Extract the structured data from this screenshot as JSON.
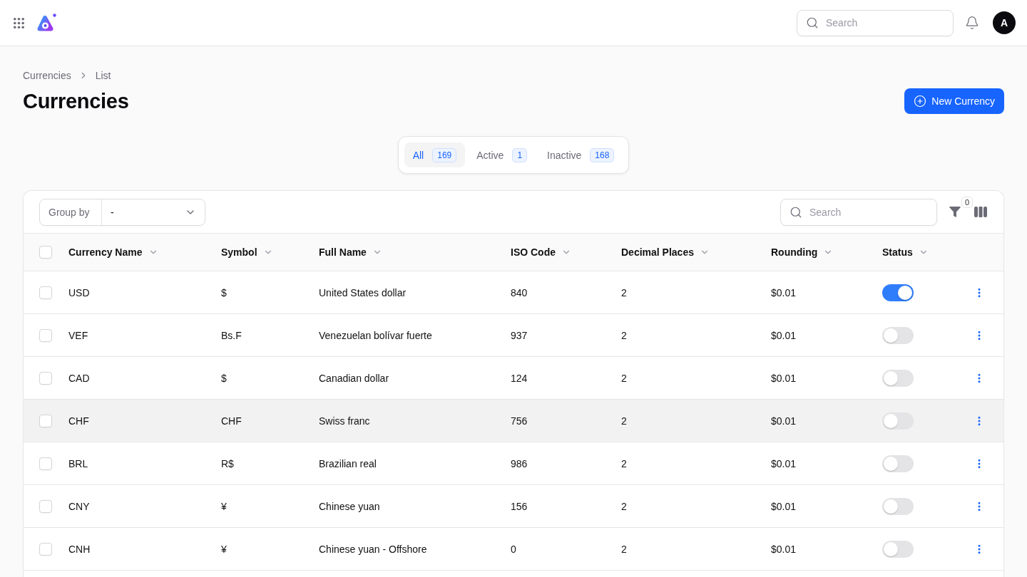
{
  "topbar": {
    "search": {
      "placeholder": "Search"
    },
    "avatar": "A"
  },
  "breadcrumb": [
    "Currencies",
    "List"
  ],
  "title": "Currencies",
  "new_button": "New Currency",
  "tabs": [
    {
      "label": "All",
      "count": "169",
      "selected": true
    },
    {
      "label": "Active",
      "count": "1",
      "selected": false
    },
    {
      "label": "Inactive",
      "count": "168",
      "selected": false
    }
  ],
  "toolbar": {
    "group_by": {
      "label": "Group by",
      "value": "-"
    },
    "search": {
      "placeholder": "Search"
    },
    "filter_count": "0"
  },
  "table": {
    "select_all": {
      "checked": false
    },
    "columns": [
      "Currency Name",
      "Symbol",
      "Full Name",
      "ISO Code",
      "Decimal Places",
      "Rounding",
      "Status"
    ],
    "rows": [
      {
        "checked": false,
        "hovered": false,
        "cells": [
          "USD",
          "$",
          "United States dollar",
          "840",
          "2",
          "$0.01"
        ],
        "on": true
      },
      {
        "checked": false,
        "hovered": false,
        "cells": [
          "VEF",
          "Bs.F",
          "Venezuelan bolívar fuerte",
          "937",
          "2",
          "$0.01"
        ],
        "on": false
      },
      {
        "checked": false,
        "hovered": false,
        "cells": [
          "CAD",
          "$",
          "Canadian dollar",
          "124",
          "2",
          "$0.01"
        ],
        "on": false
      },
      {
        "checked": false,
        "hovered": true,
        "cells": [
          "CHF",
          "CHF",
          "Swiss franc",
          "756",
          "2",
          "$0.01"
        ],
        "on": false
      },
      {
        "checked": false,
        "hovered": false,
        "cells": [
          "BRL",
          "R$",
          "Brazilian real",
          "986",
          "2",
          "$0.01"
        ],
        "on": false
      },
      {
        "checked": false,
        "hovered": false,
        "cells": [
          "CNY",
          "¥",
          "Chinese yuan",
          "156",
          "2",
          "$0.01"
        ],
        "on": false
      },
      {
        "checked": false,
        "hovered": false,
        "cells": [
          "CNH",
          "¥",
          "Chinese yuan - Offshore",
          "0",
          "2",
          "$0.01"
        ],
        "on": false
      }
    ]
  }
}
